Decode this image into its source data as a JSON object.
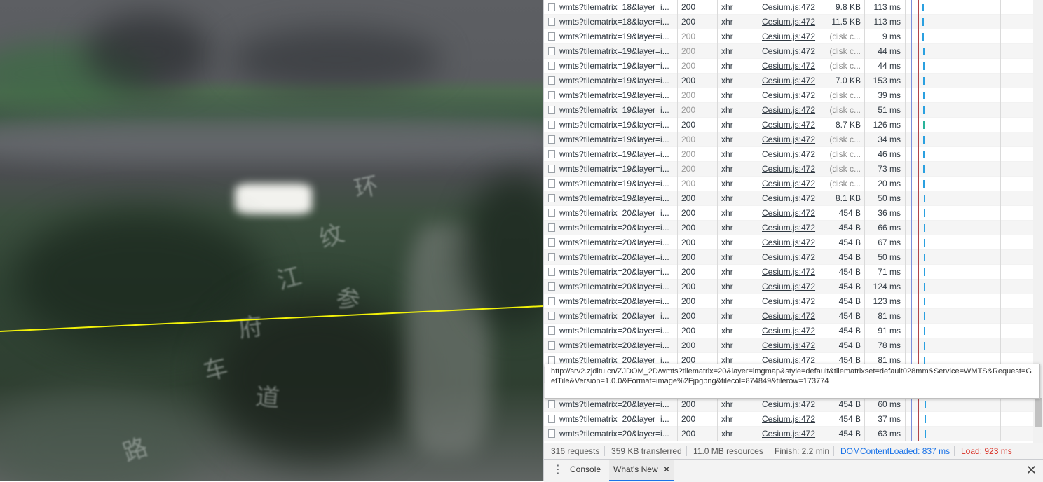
{
  "network": {
    "rows": [
      {
        "name": "wmts?tilematrix=18&layer=i...",
        "status": "200",
        "type": "xhr",
        "initiator": "Cesium.js:472",
        "size": "9.8 KB",
        "time": "113 ms",
        "cached": false
      },
      {
        "name": "wmts?tilematrix=18&layer=i...",
        "status": "200",
        "type": "xhr",
        "initiator": "Cesium.js:472",
        "size": "11.5 KB",
        "time": "113 ms",
        "cached": false
      },
      {
        "name": "wmts?tilematrix=19&layer=i...",
        "status": "200",
        "type": "xhr",
        "initiator": "Cesium.js:472",
        "size": "(disk c...",
        "time": "9 ms",
        "cached": true
      },
      {
        "name": "wmts?tilematrix=19&layer=i...",
        "status": "200",
        "type": "xhr",
        "initiator": "Cesium.js:472",
        "size": "(disk c...",
        "time": "44 ms",
        "cached": true
      },
      {
        "name": "wmts?tilematrix=19&layer=i...",
        "status": "200",
        "type": "xhr",
        "initiator": "Cesium.js:472",
        "size": "(disk c...",
        "time": "44 ms",
        "cached": true
      },
      {
        "name": "wmts?tilematrix=19&layer=i...",
        "status": "200",
        "type": "xhr",
        "initiator": "Cesium.js:472",
        "size": "7.0 KB",
        "time": "153 ms",
        "cached": false
      },
      {
        "name": "wmts?tilematrix=19&layer=i...",
        "status": "200",
        "type": "xhr",
        "initiator": "Cesium.js:472",
        "size": "(disk c...",
        "time": "39 ms",
        "cached": true
      },
      {
        "name": "wmts?tilematrix=19&layer=i...",
        "status": "200",
        "type": "xhr",
        "initiator": "Cesium.js:472",
        "size": "(disk c...",
        "time": "51 ms",
        "cached": true
      },
      {
        "name": "wmts?tilematrix=19&layer=i...",
        "status": "200",
        "type": "xhr",
        "initiator": "Cesium.js:472",
        "size": "8.7 KB",
        "time": "126 ms",
        "cached": false
      },
      {
        "name": "wmts?tilematrix=19&layer=i...",
        "status": "200",
        "type": "xhr",
        "initiator": "Cesium.js:472",
        "size": "(disk c...",
        "time": "34 ms",
        "cached": true
      },
      {
        "name": "wmts?tilematrix=19&layer=i...",
        "status": "200",
        "type": "xhr",
        "initiator": "Cesium.js:472",
        "size": "(disk c...",
        "time": "46 ms",
        "cached": true
      },
      {
        "name": "wmts?tilematrix=19&layer=i...",
        "status": "200",
        "type": "xhr",
        "initiator": "Cesium.js:472",
        "size": "(disk c...",
        "time": "73 ms",
        "cached": true
      },
      {
        "name": "wmts?tilematrix=19&layer=i...",
        "status": "200",
        "type": "xhr",
        "initiator": "Cesium.js:472",
        "size": "(disk c...",
        "time": "20 ms",
        "cached": true
      },
      {
        "name": "wmts?tilematrix=19&layer=i...",
        "status": "200",
        "type": "xhr",
        "initiator": "Cesium.js:472",
        "size": "8.1 KB",
        "time": "50 ms",
        "cached": false
      },
      {
        "name": "wmts?tilematrix=20&layer=i...",
        "status": "200",
        "type": "xhr",
        "initiator": "Cesium.js:472",
        "size": "454 B",
        "time": "36 ms",
        "cached": false
      },
      {
        "name": "wmts?tilematrix=20&layer=i...",
        "status": "200",
        "type": "xhr",
        "initiator": "Cesium.js:472",
        "size": "454 B",
        "time": "66 ms",
        "cached": false
      },
      {
        "name": "wmts?tilematrix=20&layer=i...",
        "status": "200",
        "type": "xhr",
        "initiator": "Cesium.js:472",
        "size": "454 B",
        "time": "67 ms",
        "cached": false
      },
      {
        "name": "wmts?tilematrix=20&layer=i...",
        "status": "200",
        "type": "xhr",
        "initiator": "Cesium.js:472",
        "size": "454 B",
        "time": "50 ms",
        "cached": false
      },
      {
        "name": "wmts?tilematrix=20&layer=i...",
        "status": "200",
        "type": "xhr",
        "initiator": "Cesium.js:472",
        "size": "454 B",
        "time": "71 ms",
        "cached": false
      },
      {
        "name": "wmts?tilematrix=20&layer=i...",
        "status": "200",
        "type": "xhr",
        "initiator": "Cesium.js:472",
        "size": "454 B",
        "time": "124 ms",
        "cached": false
      },
      {
        "name": "wmts?tilematrix=20&layer=i...",
        "status": "200",
        "type": "xhr",
        "initiator": "Cesium.js:472",
        "size": "454 B",
        "time": "123 ms",
        "cached": false
      },
      {
        "name": "wmts?tilematrix=20&layer=i...",
        "status": "200",
        "type": "xhr",
        "initiator": "Cesium.js:472",
        "size": "454 B",
        "time": "81 ms",
        "cached": false
      },
      {
        "name": "wmts?tilematrix=20&layer=i...",
        "status": "200",
        "type": "xhr",
        "initiator": "Cesium.js:472",
        "size": "454 B",
        "time": "91 ms",
        "cached": false
      },
      {
        "name": "wmts?tilematrix=20&layer=i...",
        "status": "200",
        "type": "xhr",
        "initiator": "Cesium.js:472",
        "size": "454 B",
        "time": "78 ms",
        "cached": false
      },
      {
        "name": "wmts?tilematrix=20&layer=i...",
        "status": "200",
        "type": "xhr",
        "initiator": "Cesium.js:472",
        "size": "454 B",
        "time": "81 ms",
        "cached": false
      },
      {
        "name": "",
        "status": "",
        "type": "",
        "initiator": "",
        "size": "",
        "time": "",
        "cached": false
      },
      {
        "name": "",
        "status": "",
        "type": "",
        "initiator": "",
        "size": "",
        "time": "",
        "cached": false
      },
      {
        "name": "wmts?tilematrix=20&layer=i...",
        "status": "200",
        "type": "xhr",
        "initiator": "Cesium.js:472",
        "size": "454 B",
        "time": "60 ms",
        "cached": false
      },
      {
        "name": "wmts?tilematrix=20&layer=i...",
        "status": "200",
        "type": "xhr",
        "initiator": "Cesium.js:472",
        "size": "454 B",
        "time": "37 ms",
        "cached": false
      },
      {
        "name": "wmts?tilematrix=20&layer=i...",
        "status": "200",
        "type": "xhr",
        "initiator": "Cesium.js:472",
        "size": "454 B",
        "time": "63 ms",
        "cached": false
      }
    ],
    "tooltip": "http://srv2.zjditu.cn/ZJDOM_2D/wmts?tilematrix=20&layer=imgmap&style=default&tilematrixset=default028mm&Service=WMTS&Request=GetTile&Version=1.0.0&Format=image%2Fjpgpng&tilecol=874849&tilerow=173774",
    "summary": {
      "requests": "316 requests",
      "transferred": "359 KB transferred",
      "resources": "11.0 MB resources",
      "finish": "Finish: 2.2 min",
      "dom_content_loaded": "DOMContentLoaded: 837 ms",
      "load": "Load: 923 ms"
    },
    "colors": {
      "dcl": "#1a73e8",
      "load": "#d93025",
      "waterfall_bar": "#2aa0e0",
      "route_line": "#f2f20a"
    }
  },
  "drawer": {
    "tabs": [
      {
        "label": "Console",
        "active": false
      },
      {
        "label": "What's New",
        "active": true
      }
    ],
    "kebab_icon": "more-vert-icon",
    "close_icon": "close-icon"
  },
  "map": {
    "labels": [
      "环",
      "纹",
      "江",
      "参",
      "府",
      "车",
      "道",
      "路"
    ]
  }
}
